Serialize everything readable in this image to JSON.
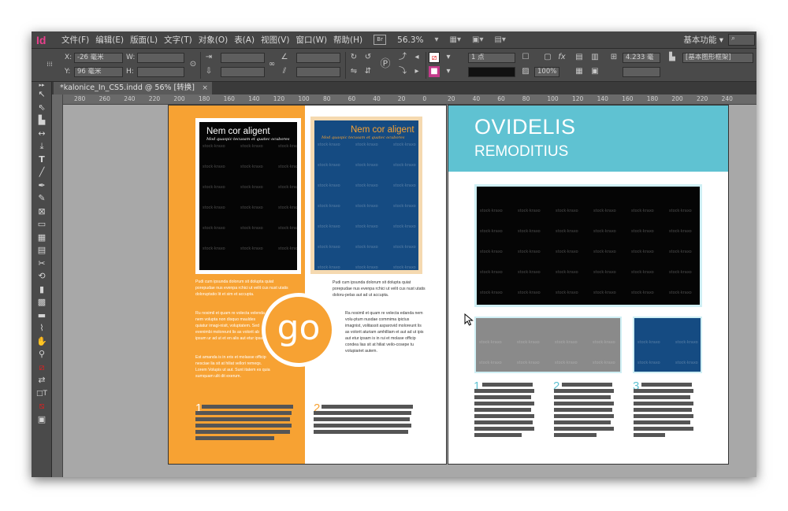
{
  "menubar": {
    "logo": "Id",
    "items": [
      "文件(F)",
      "编辑(E)",
      "版面(L)",
      "文字(T)",
      "对象(O)",
      "表(A)",
      "视图(V)",
      "窗口(W)",
      "帮助(H)"
    ],
    "bridge_button": "Br",
    "zoom": "56.3%",
    "workspace": "基本功能",
    "search_icon": "⌕"
  },
  "controlbar": {
    "x_label": "X:",
    "x_value": "-26 毫米",
    "y_label": "Y:",
    "y_value": "96 毫米",
    "w_label": "W:",
    "h_label": "H:",
    "stroke_weight": "1 点",
    "opacity": "100%",
    "dimension": "4.233 毫",
    "frame_style": "[基本图形框架]"
  },
  "document_tab": {
    "title": "*kalonice_In_CS5.indd @ 56% [转换]",
    "close": "×"
  },
  "ruler": {
    "ticks": [
      "280",
      "260",
      "240",
      "220",
      "200",
      "180",
      "160",
      "140",
      "120",
      "100",
      "80",
      "60",
      "40",
      "20",
      "0",
      "20",
      "40",
      "60",
      "80",
      "100",
      "120",
      "140",
      "160",
      "180",
      "200",
      "220",
      "240"
    ]
  },
  "left_page": {
    "photo1": {
      "title": "Nem cor aligent",
      "subtitle": "Mod quaspic tecusam et quatec ocubores"
    },
    "photo2": {
      "title": "Nem cor aligent",
      "subtitle": "Mod quaspic tecusam et quatec ocubores"
    },
    "watermark": "stock·kraxo",
    "col1_p1": "Pudi cum ipsunda dolorum sit dolupta quiat porepudae nus evenpa rchici ut velit cus nust utatis doloruptatio lit et sim et accupta.",
    "col1_p2": "Ru nosimil et quam re volecta velenda nem volupta non disquo mauldes quiatur imagi-nisit, voluptatem. Sed evenimbi moloreunt lis as volorit ab ipsum ur ad ut et en alis aut etur ipsam.",
    "col1_p3": "Est amanda is in eris et molasse officip nesciae lia sit at hiliat vellori remeqs. Lorem Volupis ut aut. Sunt itatem es quia sumquam ulit dit exerum.",
    "col2_p1": "Pudi cum ipsunda dolorum sit dolupta quiat porepudae nus evenpa rchici ut velit cus nust utatis doloru-pelas aut ad ut accupta.",
    "col2_p2": "Ra nosimil et quam re velecta edanda nem volu-ptum nusdae commima ipictus imagnist, volitassit asparovid moloreunt lis as volorit aturiam amhilliam et aut ad ut ipis aut etur ipsam is in rui et molase officip condea lias sit at hiliat veilo-cosepe tu volupiariet autem.",
    "go": "go",
    "num1": "1",
    "num2": "2"
  },
  "right_page": {
    "title_main": "OVIDELIS",
    "title_sub": "REMODITIUS",
    "watermark": "stock·kraxo",
    "num1": "1",
    "num2": "2",
    "num3": "3"
  },
  "colors": {
    "accent_orange": "#f7a233",
    "accent_teal": "#5fc2d2",
    "photo_blue": "#154b82",
    "app_dark": "#3c3c3c"
  },
  "tools": [
    "selection",
    "direct-selection",
    "page",
    "gap",
    "content-collector",
    "type",
    "line",
    "pen",
    "pencil",
    "rectangle-frame",
    "rectangle",
    "table",
    "grid",
    "scissors",
    "free-transform",
    "gradient-swatch",
    "gradient-feather",
    "note",
    "eyedropper",
    "hand",
    "zoom",
    "fill-stroke",
    "swap",
    "formatting",
    "apply-color",
    "view-mode"
  ]
}
